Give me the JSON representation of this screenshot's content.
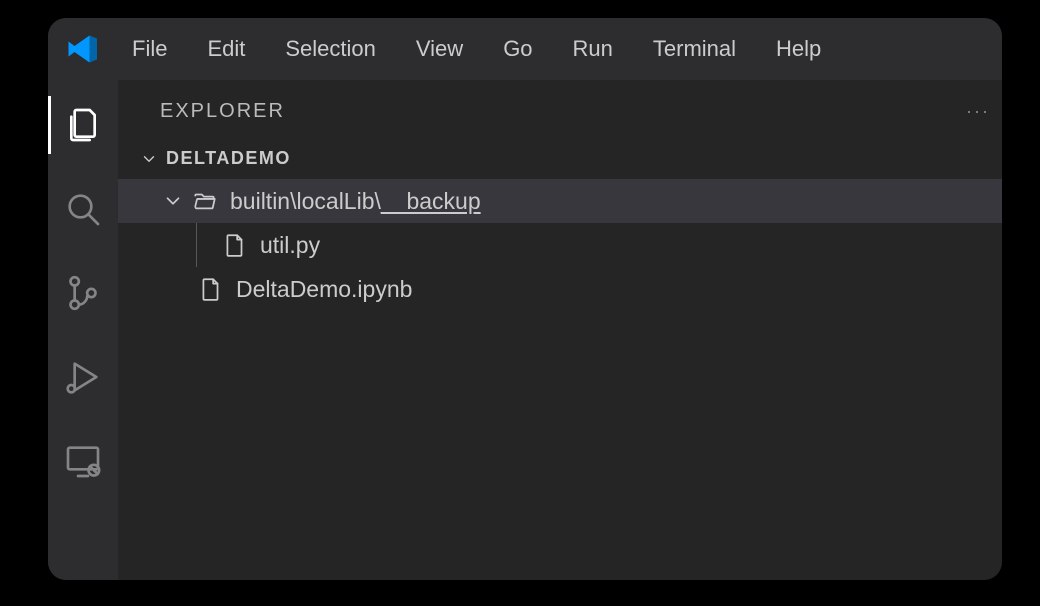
{
  "menu": {
    "file": "File",
    "edit": "Edit",
    "selection": "Selection",
    "view": "View",
    "go": "Go",
    "run": "Run",
    "terminal": "Terminal",
    "help": "Help"
  },
  "explorer": {
    "title": "EXPLORER",
    "more": "···"
  },
  "workspace": {
    "root": "DELTADEMO",
    "folder_path_1": "builtin",
    "folder_sep": "\\",
    "folder_path_2": "localLib",
    "folder_path_3": "__backup",
    "files": {
      "util": "util.py",
      "notebook": "DeltaDemo.ipynb"
    }
  }
}
